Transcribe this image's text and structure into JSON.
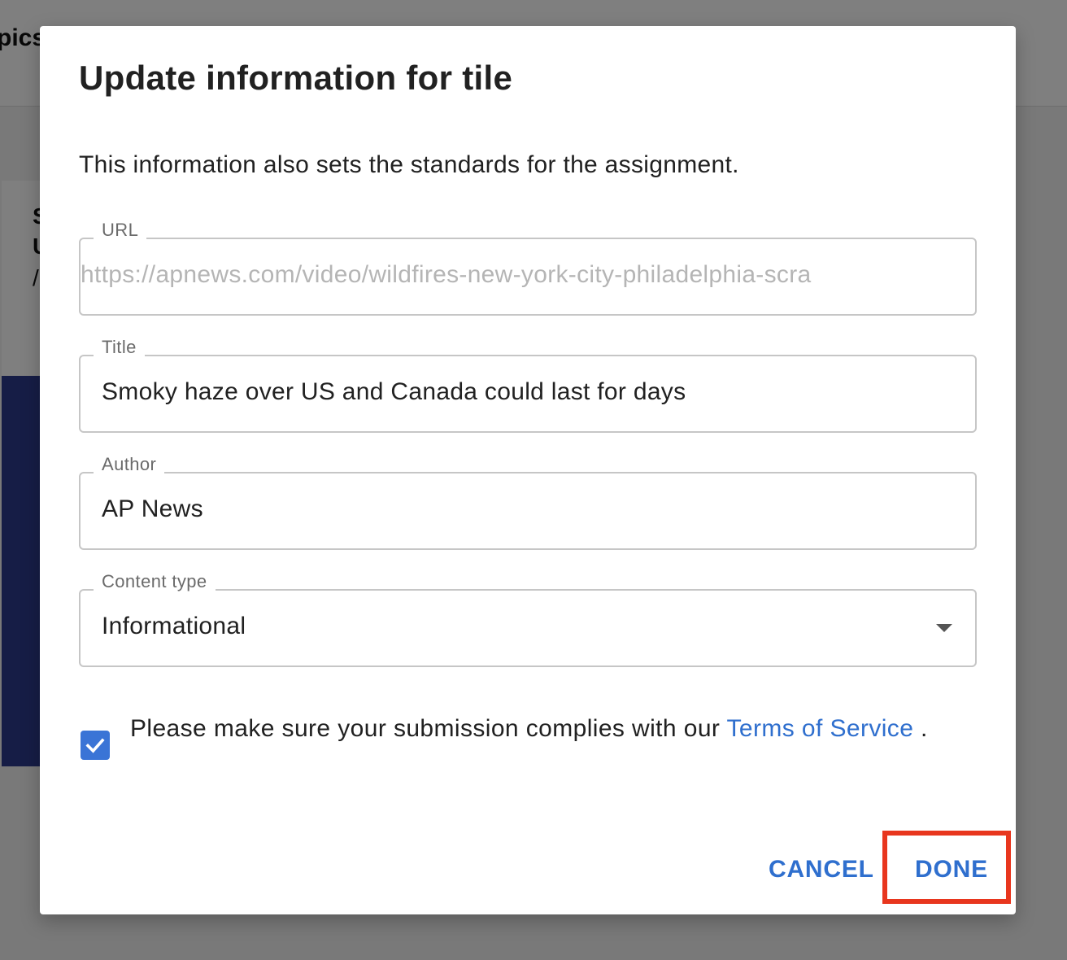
{
  "background": {
    "header_title": "pics",
    "card_lines": [
      "S",
      "U",
      "/"
    ],
    "card_image_color": "#2d3a8c"
  },
  "dialog": {
    "title": "Update information for tile",
    "description": "This information also sets the standards for the assignment.",
    "fields": {
      "url": {
        "label": "URL",
        "value": "https://apnews.com/video/wildfires-new-york-city-philadelphia-scra",
        "disabled": true
      },
      "title": {
        "label": "Title",
        "value": "Smoky haze over US and Canada could last for days"
      },
      "author": {
        "label": "Author",
        "value": "AP News"
      },
      "content_type": {
        "label": "Content type",
        "selected": "Informational",
        "icon": "chevron-down-icon"
      }
    },
    "consent": {
      "checked": true,
      "text_before": "Please make sure your submission complies with our ",
      "link_text": "Terms of Service",
      "text_after": " ."
    },
    "actions": {
      "cancel_label": "CANCEL",
      "done_label": "DONE"
    }
  },
  "colors": {
    "accent": "#2f6fce",
    "checkbox": "#3a74d6",
    "highlight": "#e8361e",
    "scrim": "rgba(0,0,0,0.5)"
  }
}
